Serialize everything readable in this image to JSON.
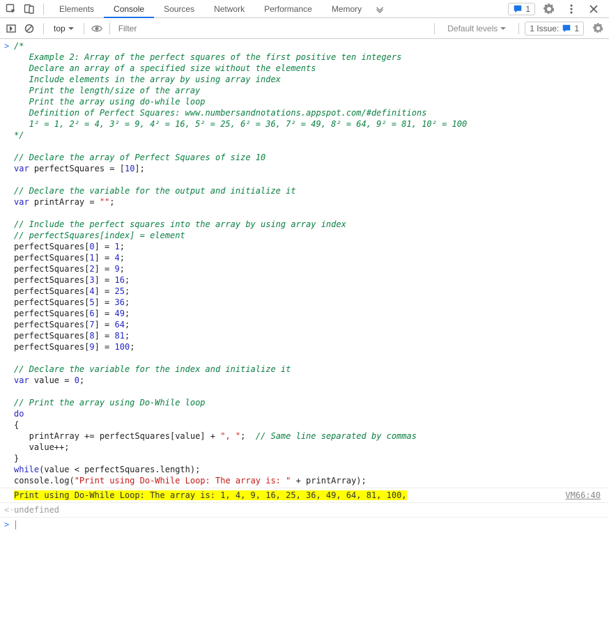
{
  "toolbar": {
    "tabs": [
      "Elements",
      "Console",
      "Sources",
      "Network",
      "Performance",
      "Memory"
    ],
    "active_tab_index": 1,
    "msg_count": "1"
  },
  "filterbar": {
    "context": "top",
    "filter_placeholder": "Filter",
    "levels_label": "Default levels",
    "issue_label": "1 Issue:",
    "issue_count": "1"
  },
  "code": {
    "block1": "/*\n   Example 2: Array of the perfect squares of the first positive ten integers\n   Declare an array of a specified size without the elements\n   Include elements in the array by using array index\n   Print the length/size of the array\n   Print the array using do-while loop\n   Definition of Perfect Squares: www.numbersandnotations.appspot.com/#definitions\n   1² = 1, 2² = 4, 3² = 9, 4² = 16, 5² = 25, 6² = 36, 7² = 49, 8² = 64, 9² = 81, 10² = 100\n*/",
    "c2": "// Declare the array of Perfect Squares of size 10",
    "l_var1a": "var",
    "l_var1b": " perfectSquares = [",
    "l_var1c": "10",
    "l_var1d": "];",
    "c3": "// Declare the variable for the output and initialize it",
    "l_var2a": "var",
    "l_var2b": " printArray = ",
    "l_var2c": "\"\"",
    "l_var2d": ";",
    "c4": "// Include the perfect squares into the array by using array index",
    "c5": "// perfectSquares[index] = element",
    "idx0": "perfectSquares[",
    "n0": "0",
    "eqs": "] = ",
    "v0": "1",
    "sc": ";",
    "n1": "1",
    "v1": "4",
    "n2": "2",
    "v2": "9",
    "n3": "3",
    "v3": "16",
    "n4": "4",
    "v4": "25",
    "n5": "5",
    "v5": "36",
    "n6": "6",
    "v6": "49",
    "n7": "7",
    "v7": "64",
    "n8": "8",
    "v8": "81",
    "n9": "9",
    "v9": "100",
    "c6": "// Declare the variable for the index and initialize it",
    "l_var3a": "var",
    "l_var3b": " value = ",
    "l_var3c": "0",
    "l_var3d": ";",
    "c7": "// Print the array using Do-While loop",
    "do": "do",
    "br1": "{",
    "body1": "   printArray += perfectSquares[value] + ",
    "body1s": "\", \"",
    "body1e": ";  ",
    "body1c": "// Same line separated by commas",
    "body2": "   value++;",
    "br2": "}",
    "while1": "while",
    "while2": "(value < perfectSquares.length);",
    "log1": "console.log(",
    "log2": "\"Print using Do-While Loop: The array is: \"",
    "log3": " + printArray);"
  },
  "output": {
    "log": "Print using Do-While Loop: The array is: 1, 4, 9, 16, 25, 36, 49, 64, 81, 100, ",
    "source": "VM66:40",
    "undefined": "undefined"
  }
}
